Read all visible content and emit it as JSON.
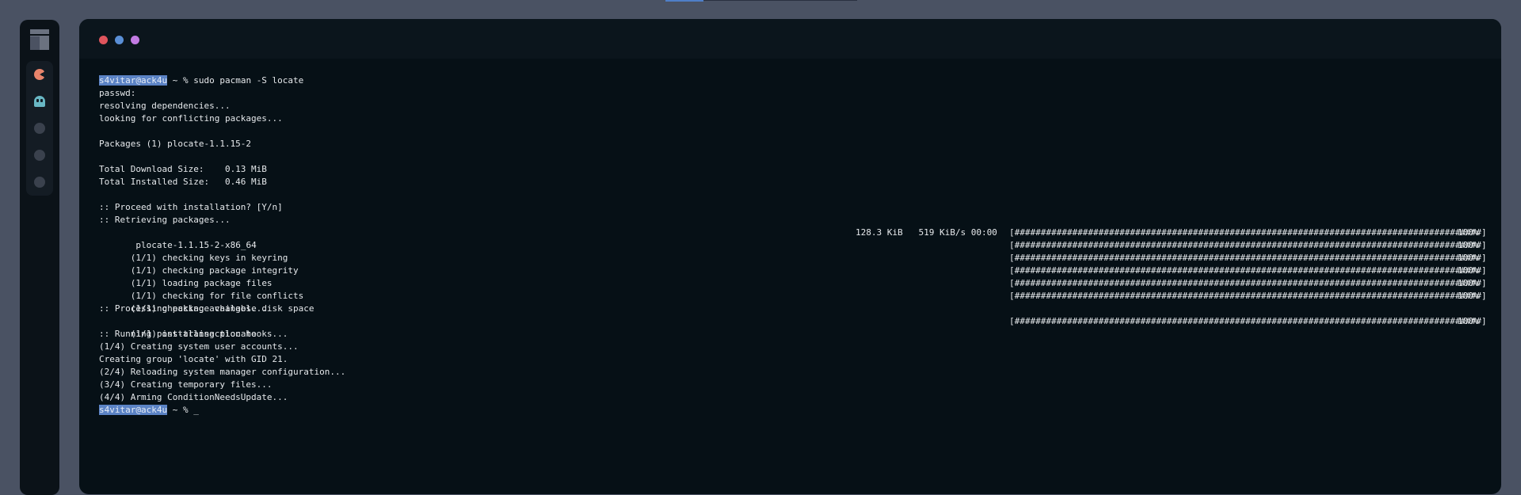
{
  "terminal": {
    "prompt_user": "s4vitar@ack4u",
    "prompt_suffix": " ~ % ",
    "command": "sudo pacman -S locate",
    "final_prompt_suffix": " ~ % ",
    "cursor": "_",
    "lines": {
      "passwd": "passwd:",
      "resolving": "resolving dependencies...",
      "looking": "looking for conflicting packages...",
      "packages": "Packages (1) plocate-1.1.15-2",
      "download_size": "Total Download Size:    0.13 MiB",
      "installed_size": "Total Installed Size:   0.46 MiB",
      "proceed": ":: Proceed with installation? [Y/n]",
      "retrieving": ":: Retrieving packages...",
      "pkg_name": " plocate-1.1.15-2-x86_64",
      "pkg_stats": "128.3 KiB   519 KiB/s 00:00",
      "keys": "(1/1) checking keys in keyring",
      "integrity": "(1/1) checking package integrity",
      "loading": "(1/1) loading package files",
      "conflicts": "(1/1) checking for file conflicts",
      "disk": "(1/1) checking available disk space",
      "processing": ":: Processing package changes...",
      "installing": "(1/1) installing plocate",
      "hooks": ":: Running post-transaction hooks...",
      "hook1": "(1/4) Creating system user accounts...",
      "group": "Creating group 'locate' with GID 21.",
      "hook2": "(2/4) Reloading system manager configuration...",
      "hook3": "(3/4) Creating temporary files...",
      "hook4": "(4/4) Arming ConditionNeedsUpdate..."
    },
    "progress_bar": "[#########################################################################################]",
    "progress_pct": "100%",
    "progress_value": 1.0
  },
  "colors": {
    "background": "#4a5263",
    "window": "#061016",
    "prompt_highlight": "#5b83c5",
    "traffic_red": "#e0555d",
    "traffic_blue": "#5a8fd6",
    "traffic_purple": "#c27be3"
  },
  "icons": {
    "logo": "bspwm-logo-icon",
    "ws1": "pacman-icon",
    "ws2": "ghost-icon"
  }
}
